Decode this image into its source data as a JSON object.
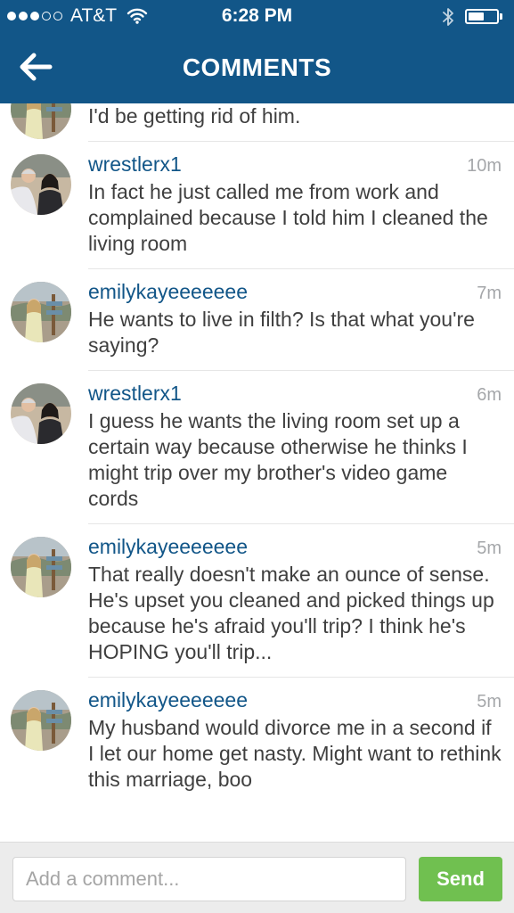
{
  "status_bar": {
    "carrier": "AT&T",
    "time": "6:28 PM",
    "signal_bars_filled": 3,
    "signal_bars_total": 5,
    "battery_level": 0.55
  },
  "nav": {
    "title": "COMMENTS",
    "back_icon": "arrow-left-icon"
  },
  "comments": [
    {
      "username": "",
      "time": "",
      "text": "I'd be getting rid of him.",
      "avatar": "woman-outdoors"
    },
    {
      "username": "wrestlerx1",
      "time": "10m",
      "text": "In fact he just called me from work and complained because I told him I cleaned the living room",
      "avatar": "couple"
    },
    {
      "username": "emilykayeeeeeee",
      "time": "7m",
      "text": "He wants to live in filth? Is that what you're saying?",
      "avatar": "woman-outdoors"
    },
    {
      "username": "wrestlerx1",
      "time": "6m",
      "text": "I guess he wants the living room set up a certain way because otherwise he thinks I might trip over my brother's video game cords",
      "avatar": "couple"
    },
    {
      "username": "emilykayeeeeeee",
      "time": "5m",
      "text": "That really doesn't make an ounce of sense. He's upset you cleaned and picked things up because he's afraid you'll trip? I think he's HOPING you'll trip...",
      "avatar": "woman-outdoors"
    },
    {
      "username": "emilykayeeeeeee",
      "time": "5m",
      "text": "My husband would divorce me in a second if I let our home get nasty. Might want to rethink this marriage, boo",
      "avatar": "woman-outdoors"
    }
  ],
  "composer": {
    "placeholder": "Add a comment...",
    "value": "",
    "send_label": "Send",
    "send_color": "#70c050"
  },
  "colors": {
    "header": "#125688",
    "username": "#125688",
    "timestamp": "#a5a7aa",
    "text": "#3f3f3f"
  }
}
